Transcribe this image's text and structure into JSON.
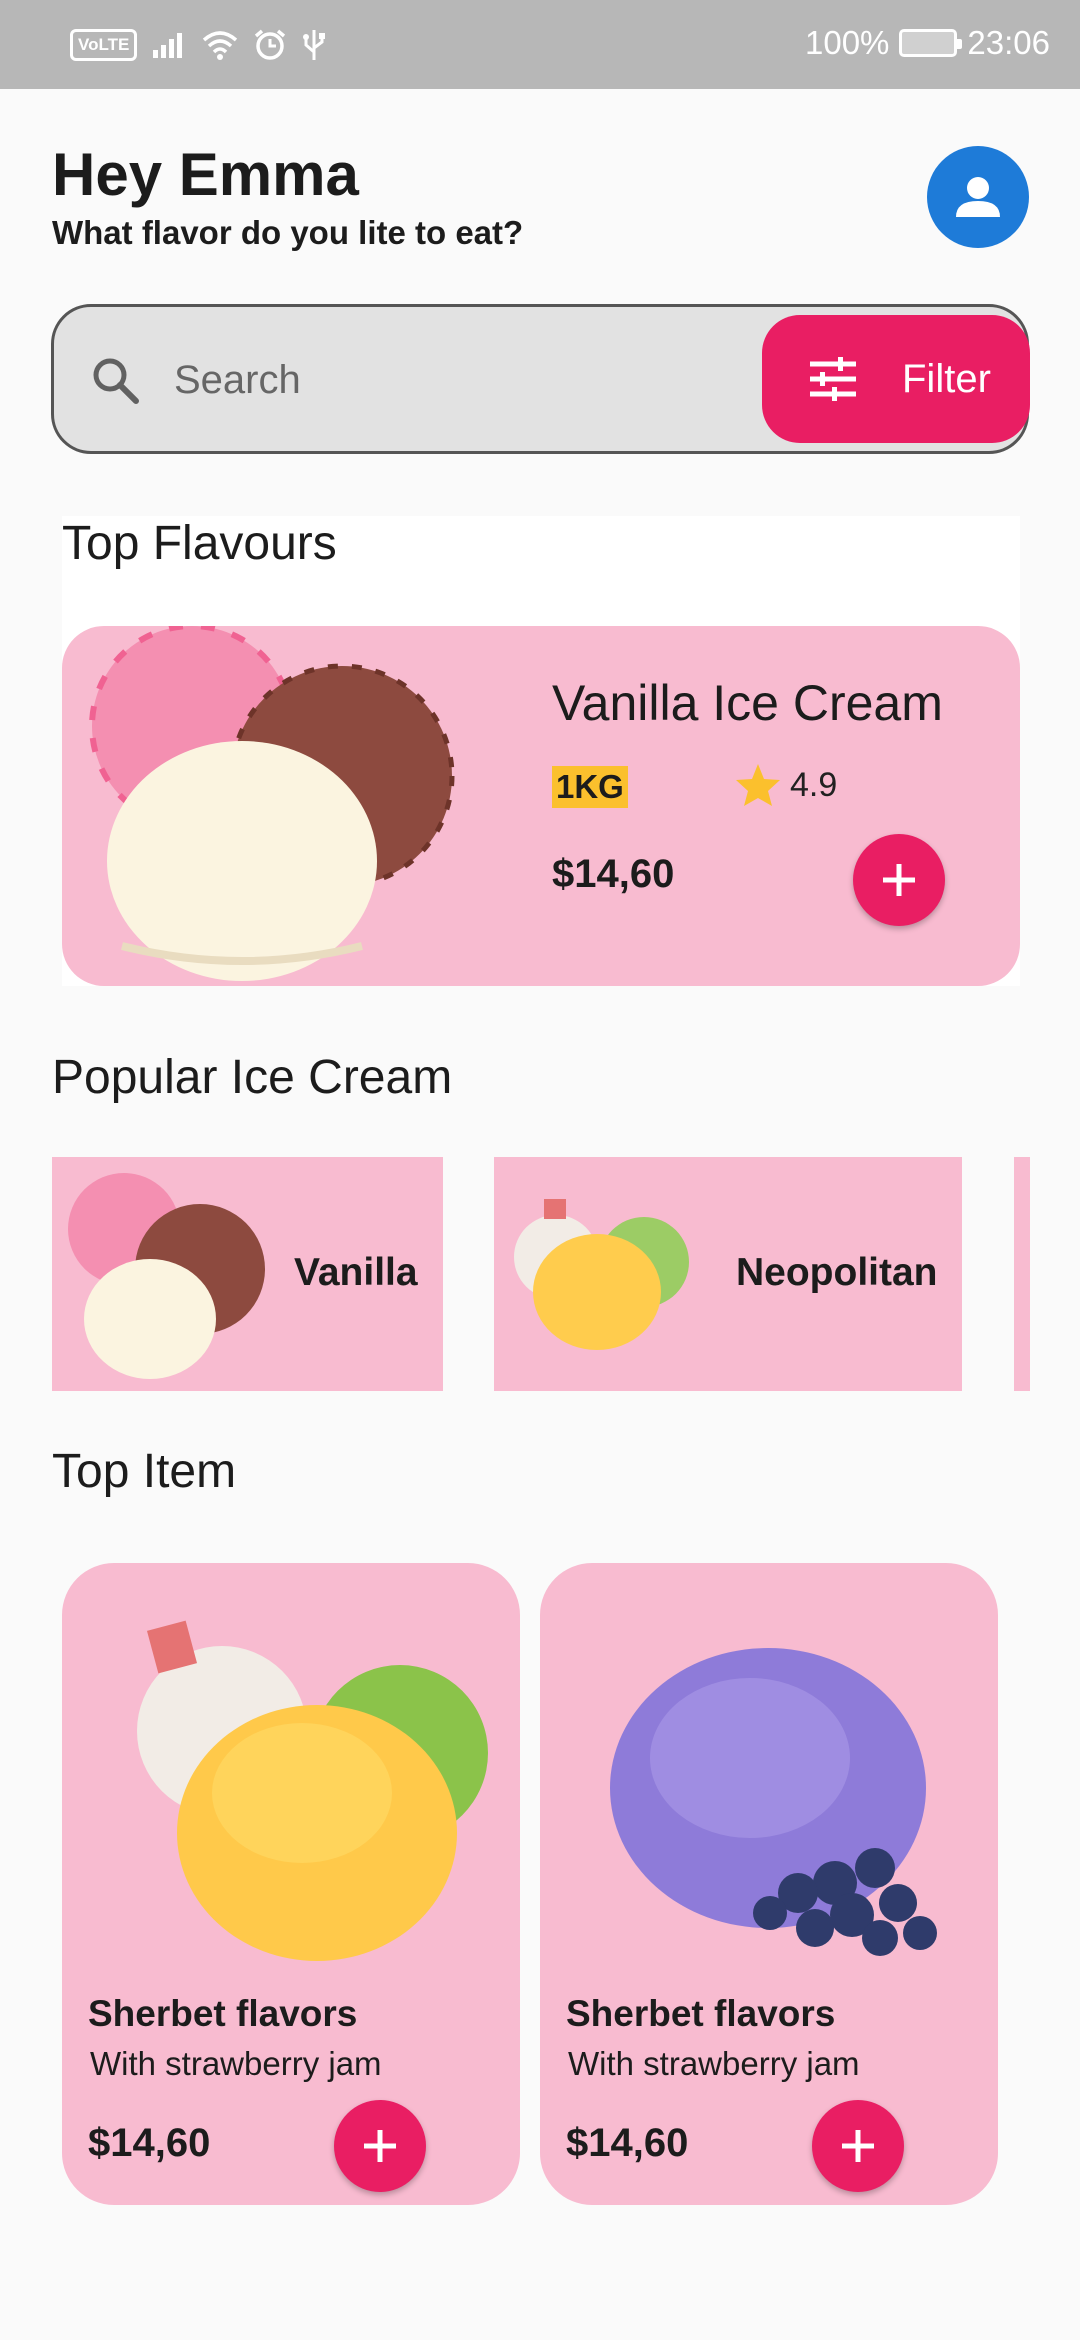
{
  "status_bar": {
    "volte": "VoLTE",
    "battery": "100%",
    "time": "23:06"
  },
  "header": {
    "greeting": "Hey Emma",
    "subtitle": "What flavor do you lite to eat?"
  },
  "search": {
    "placeholder": "Search",
    "filter_label": "Filter"
  },
  "top_flavours": {
    "title": "Top Flavours",
    "item": {
      "name": "Vanilla Ice Cream",
      "weight": "1KG",
      "rating": "4.9",
      "price": "$14,60"
    }
  },
  "popular": {
    "title": "Popular Ice Cream",
    "items": [
      {
        "label": "Vanilla"
      },
      {
        "label": "Neopolitan"
      }
    ]
  },
  "top_item": {
    "title": "Top Item",
    "items": [
      {
        "title": "Sherbet flavors",
        "subtitle": "With strawberry jam",
        "price": "$14,60"
      },
      {
        "title": "Sherbet flavors",
        "subtitle": "With strawberry jam",
        "price": "$14,60"
      }
    ]
  },
  "colors": {
    "accent": "#e91e63",
    "card": "#f8bbd0",
    "avatar": "#1e7bd8",
    "badge": "#fbc02d",
    "star": "#fbc02d"
  }
}
